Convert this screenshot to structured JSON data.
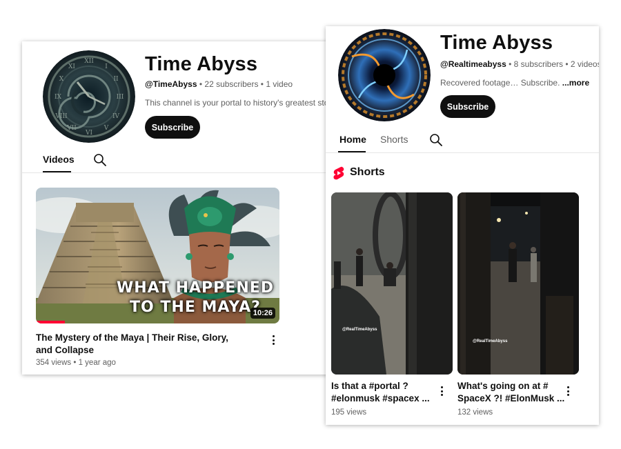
{
  "left_channel": {
    "title": "Time Abyss",
    "handle": "@TimeAbyss",
    "subscribers": "22 subscribers",
    "video_count": "1 video",
    "separator": "•",
    "description": "This channel is your portal to history's greatest sto",
    "subscribe_label": "Subscribe",
    "tabs": [
      {
        "label": "Videos",
        "active": true
      }
    ],
    "video": {
      "overlay_line1": "WHAT HAPPENED",
      "overlay_line2": "TO THE MAYA?",
      "duration": "10:26",
      "watch_progress": 0.12,
      "title": "The Mystery of the Maya | Their Rise, Glory, and Collapse",
      "views": "354 views",
      "age": "1 year ago"
    }
  },
  "right_channel": {
    "title": "Time Abyss",
    "handle": "@Realtimeabyss",
    "subscribers": "8 subscribers",
    "video_count": "2 videos",
    "separator": "•",
    "description": "Recovered footage… Subscribe.",
    "more_label": "...more",
    "subscribe_label": "Subscribe",
    "tabs": [
      {
        "label": "Home",
        "active": true
      },
      {
        "label": "Shorts",
        "active": false
      }
    ],
    "section_title": "Shorts",
    "shorts": [
      {
        "watermark": "@RealTimeAbyss",
        "title_line1": "Is that a #portal ?",
        "title_line2": "#elonmusk #spacex ...",
        "views": "195 views"
      },
      {
        "watermark": "@RealTimeAbyss",
        "title_line1": "What's going on at #",
        "title_line2": "SpaceX ?! #ElonMusk ...",
        "views": "132 views"
      }
    ]
  },
  "icons": {
    "search": "search-icon",
    "more": "more-vert-icon",
    "shorts": "shorts-logo-icon"
  },
  "colors": {
    "subscribe_bg": "#0f0f0f",
    "shorts_red": "#ff0033",
    "progress": "#ff0033"
  }
}
